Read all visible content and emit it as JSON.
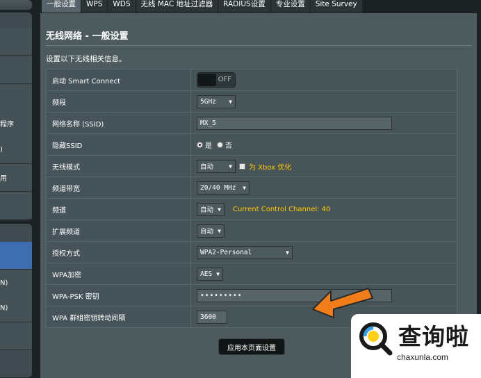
{
  "sidebar": {
    "items": [
      {
        "label": ""
      },
      {
        "label": ""
      },
      {
        "label": ""
      },
      {
        "label": "程序"
      },
      {
        "label": ")"
      },
      {
        "label": ""
      },
      {
        "label": "用"
      },
      {
        "label": ""
      },
      {
        "label": ""
      },
      {
        "label": "N)"
      },
      {
        "label": "N)"
      },
      {
        "label": ""
      }
    ]
  },
  "tabs": [
    {
      "label": "一般设置",
      "active": true
    },
    {
      "label": "WPS"
    },
    {
      "label": "WDS"
    },
    {
      "label": "无线 MAC 地址过滤器"
    },
    {
      "label": "RADIUS设置"
    },
    {
      "label": "专业设置"
    },
    {
      "label": "Site Survey"
    }
  ],
  "page": {
    "title": "无线网络 - 一般设置",
    "description": "设置以下无线相关信息。"
  },
  "form": {
    "smart_connect": {
      "label": "启动 Smart Connect",
      "state": "OFF"
    },
    "band": {
      "label": "频段",
      "value": "5GHz"
    },
    "ssid": {
      "label": "网络名称 (SSID)",
      "value": "MX_5"
    },
    "hide_ssid": {
      "label": "隐藏SSID",
      "yes": "是",
      "no": "否"
    },
    "wireless_mode": {
      "label": "无线模式",
      "value": "自动",
      "xbox": "为 Xbox 优化"
    },
    "bandwidth": {
      "label": "频道带宽",
      "value": "20/40 MHz"
    },
    "channel": {
      "label": "频道",
      "value": "自动",
      "current": "Current Control Channel: 40"
    },
    "ext_channel": {
      "label": "扩展频道",
      "value": "自动"
    },
    "auth": {
      "label": "授权方式",
      "value": "WPA2-Personal"
    },
    "wpa_enc": {
      "label": "WPA加密",
      "value": "AES"
    },
    "psk": {
      "label": "WPA-PSK 密钥",
      "value": "•••••••••"
    },
    "rekey": {
      "label": "WPA 群组密钥转动间隔",
      "value": "3600"
    }
  },
  "apply_label": "应用本页面设置",
  "watermark": {
    "name": "查询啦",
    "url": "chaxunla.com"
  },
  "colors": {
    "accent_yellow": "#ffcc00",
    "arrow": "#f07d1a",
    "panel": "#4d5b5e"
  }
}
